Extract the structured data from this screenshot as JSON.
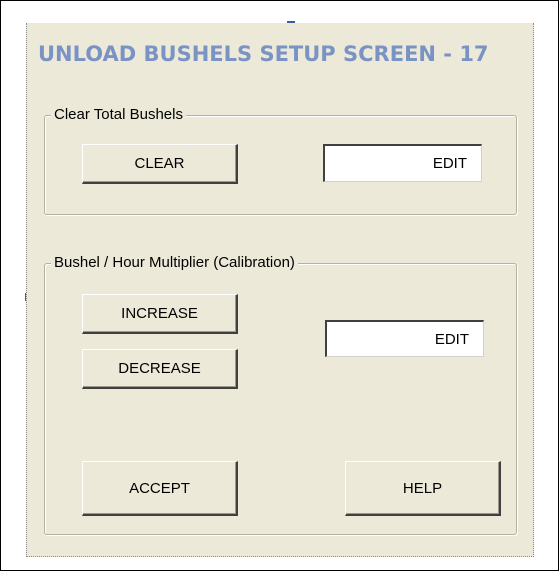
{
  "window": {
    "title": "UNLOAD BUSHELS SETUP SCREEN - 17",
    "title_color": "#7a93c5",
    "background": "#ece9d8"
  },
  "clear_group": {
    "legend": "Clear Total Bushels",
    "clear_label": "CLEAR",
    "edit_value": "EDIT"
  },
  "calibration_group": {
    "legend": "Bushel / Hour Multiplier (Calibration)",
    "increase_label": "INCREASE",
    "decrease_label": "DECREASE",
    "edit_value": "EDIT"
  },
  "footer": {
    "accept_label": "ACCEPT",
    "help_label": "HELP"
  }
}
